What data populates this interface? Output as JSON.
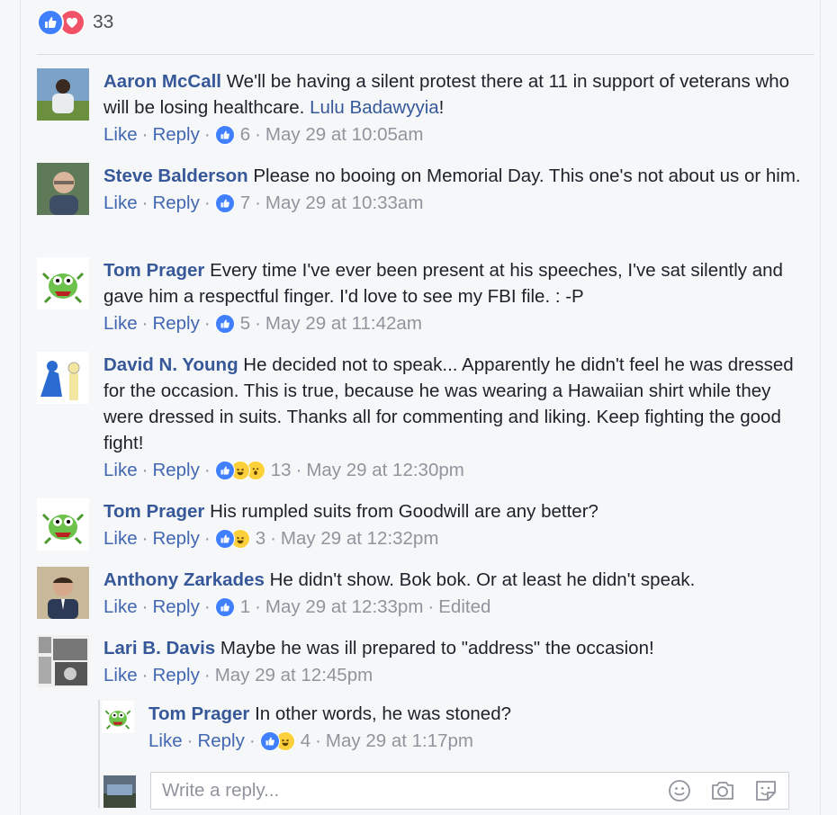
{
  "reactions_summary": {
    "count": "33",
    "icons": [
      "like-icon",
      "love-icon"
    ]
  },
  "comments": [
    {
      "author": "Aaron McCall",
      "text": "We'll be having a silent protest there at 11 in support of veterans who will be losing healthcare.",
      "mention": "Lulu Badawyyia",
      "after_mention": "!",
      "like": "Like",
      "reply": "Reply",
      "reactions": [
        "like"
      ],
      "count": "6",
      "time": "May 29 at 10:05am"
    },
    {
      "author": "Steve Balderson",
      "text": "Please no booing on Memorial Day. This one's not about us or him.",
      "like": "Like",
      "reply": "Reply",
      "reactions": [
        "like"
      ],
      "count": "7",
      "time": "May 29 at 10:33am"
    },
    {
      "author": "Tom Prager",
      "text": "Every time I've ever been present at his speeches, I've sat silently and gave him a respectful finger. I'd love to see my FBI file. : -P",
      "like": "Like",
      "reply": "Reply",
      "reactions": [
        "like"
      ],
      "count": "5",
      "time": "May 29 at 11:42am"
    },
    {
      "author": "David N. Young",
      "text": "He decided not to speak... Apparently he didn't feel he was dressed for the occasion. This is true, because he was wearing a Hawaiian shirt while they were dressed in suits. Thanks all for commenting and liking. Keep fighting the good fight!",
      "like": "Like",
      "reply": "Reply",
      "reactions": [
        "like",
        "haha",
        "wow"
      ],
      "count": "13",
      "time": "May 29 at 12:30pm"
    },
    {
      "author": "Tom Prager",
      "text": "His rumpled suits from Goodwill are any better?",
      "like": "Like",
      "reply": "Reply",
      "reactions": [
        "like",
        "haha"
      ],
      "count": "3",
      "time": "May 29 at 12:32pm"
    },
    {
      "author": "Anthony Zarkades",
      "text": "He didn't show. Bok bok. Or at least he didn't speak.",
      "like": "Like",
      "reply": "Reply",
      "reactions": [
        "like"
      ],
      "count": "1",
      "time": "May 29 at 12:33pm",
      "edited": "Edited"
    },
    {
      "author": "Lari B. Davis",
      "text": "Maybe he was ill prepared to \"address\" the occasion!",
      "like": "Like",
      "reply": "Reply",
      "time": "May 29 at 12:45pm"
    }
  ],
  "reply": {
    "author": "Tom Prager",
    "text": "In other words, he was stoned?",
    "like": "Like",
    "reply": "Reply",
    "reactions": [
      "like",
      "haha"
    ],
    "count": "4",
    "time": "May 29 at 1:17pm"
  },
  "write_reply": {
    "placeholder": "Write a reply...",
    "icons": [
      "emoji-icon",
      "camera-icon",
      "sticker-icon"
    ]
  },
  "colors": {
    "link": "#365899",
    "meta": "#90949c",
    "like_blue": "#4080ff",
    "love_red": "#f25268",
    "haha_yellow": "#fcd03b"
  }
}
